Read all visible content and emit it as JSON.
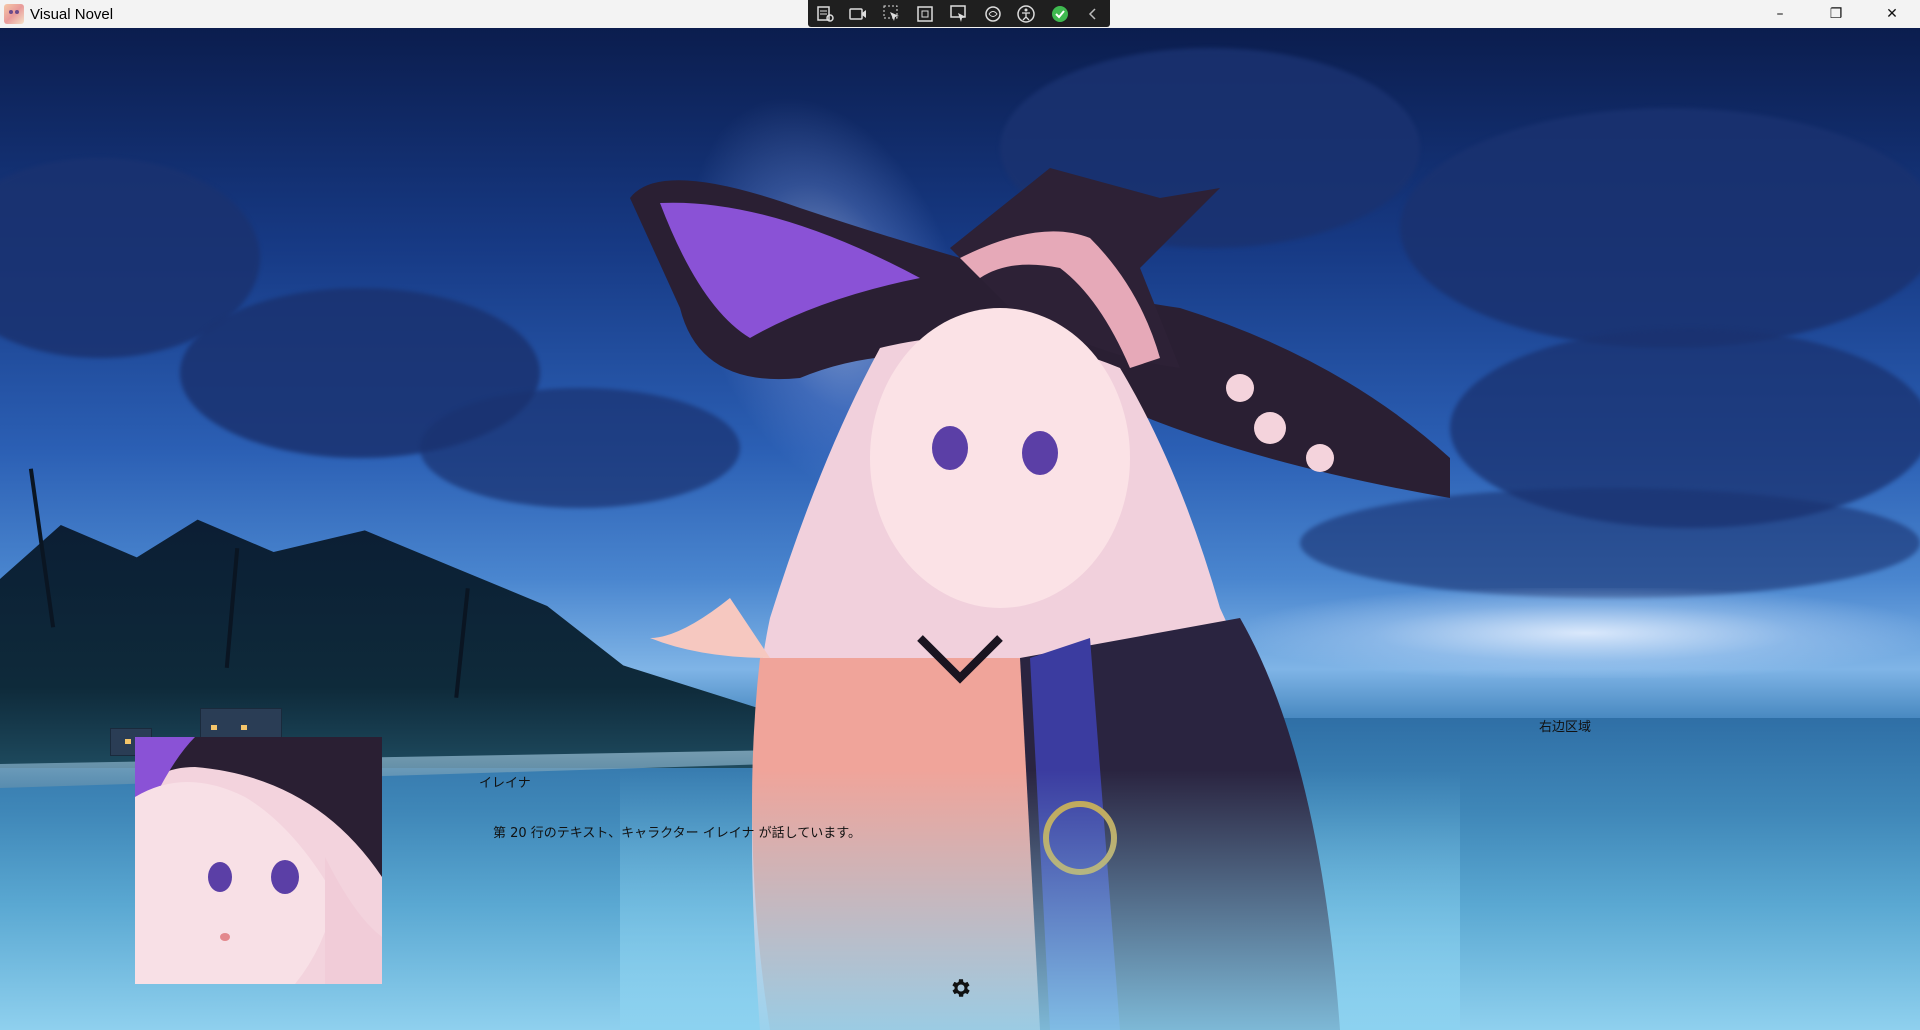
{
  "window": {
    "title": "Visual Novel",
    "controls": {
      "minimize": "–",
      "restore": "❐",
      "close": "✕"
    }
  },
  "debug_toolbar": {
    "tools": [
      "live-visual-tree-icon",
      "record-icon",
      "select-element-icon",
      "display-layout-adorners-icon",
      "track-focused-element-icon",
      "binding-failures-icon",
      "accessibility-icon",
      "hot-reload-status-icon",
      "collapse-toolbar-icon"
    ]
  },
  "dialogue": {
    "speaker_name": "イレイナ",
    "text": "第 20 行のテキスト、キャラクター イレイナ が話しています。"
  },
  "right_area_label": "右边区域",
  "colors": {
    "sky_top": "#0b1d4e",
    "sea": "#3f87b8",
    "hat_purple": "#7a47c9",
    "hair_pink": "#f1d0dc"
  }
}
